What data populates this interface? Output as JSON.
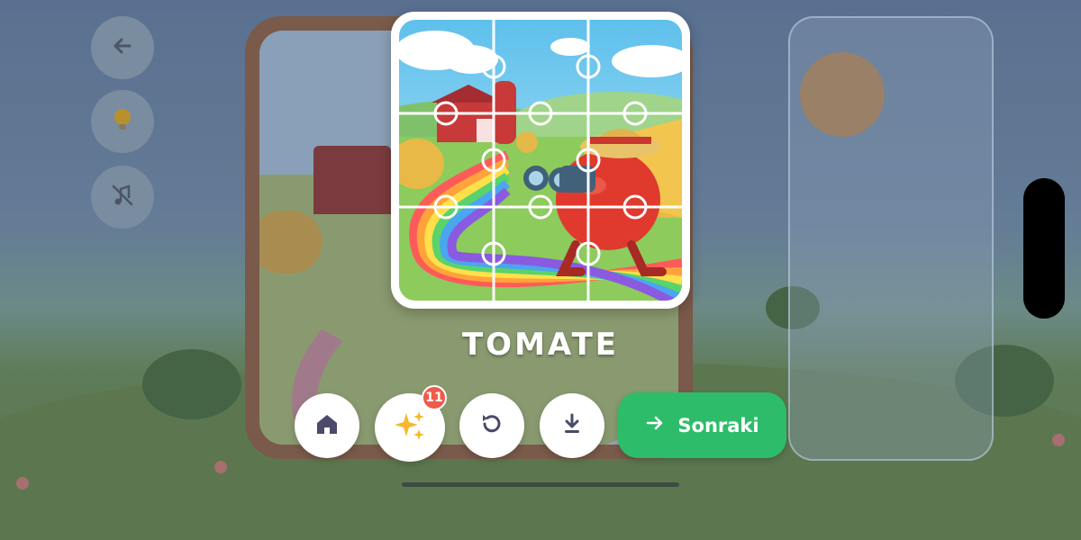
{
  "puzzle": {
    "title": "TOMATE"
  },
  "left_controls": {
    "back_icon": "arrow-left-icon",
    "hint_icon": "lightbulb-icon",
    "music_icon": "music-off-icon"
  },
  "toolbar": {
    "home_icon": "home-icon",
    "sparkles_icon": "sparkles-icon",
    "sparkles_badge": "11",
    "restart_icon": "restart-icon",
    "download_icon": "download-icon",
    "next_label": "Sonraki",
    "next_icon": "arrow-right-icon"
  },
  "colors": {
    "next_button": "#2dbd6a",
    "badge": "#ef5a4a",
    "icon": "#4a4a6a",
    "sparkle": "#f5b82e"
  }
}
